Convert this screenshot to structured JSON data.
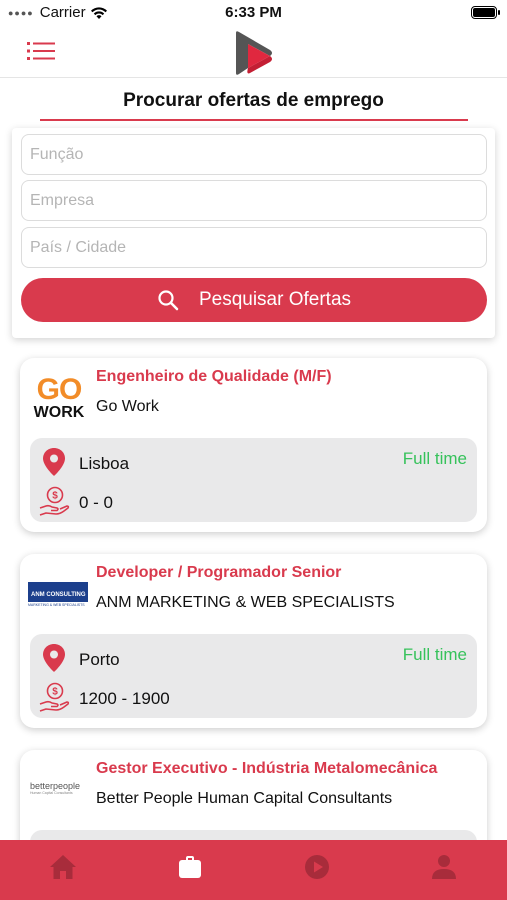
{
  "status_bar": {
    "carrier": "Carrier",
    "time": "6:33 PM"
  },
  "header": {
    "menu_icon": "menu-icon",
    "logo_icon": "play-logo-icon"
  },
  "page": {
    "title": "Procurar ofertas de emprego"
  },
  "search": {
    "role_placeholder": "Função",
    "company_placeholder": "Empresa",
    "location_placeholder": "País / Cidade",
    "button_label": "Pesquisar Ofertas"
  },
  "jobs": [
    {
      "title": "Engenheiro de Qualidade (M/F)",
      "company": "Go Work",
      "logo_text_top": "GO",
      "logo_text_bottom": "WORK",
      "location": "Lisboa",
      "type": "Full time",
      "salary": "0 - 0"
    },
    {
      "title": "Developer / Programador Senior",
      "company": "ANM MARKETING & WEB SPECIALISTS",
      "logo_text_top": "ANM CONSULTING",
      "logo_text_bottom": "MARKETING & WEB SPECIALISTS",
      "location": "Porto",
      "type": "Full time",
      "salary": "1200 - 1900"
    },
    {
      "title": "Gestor Executivo - Indústria Metalomecânica",
      "company": "Better People Human Capital Consultants",
      "logo_text_top": "betterpeople",
      "logo_text_bottom": "Human Capital Consultants",
      "location": "",
      "type": "",
      "salary": ""
    }
  ],
  "tabs": [
    {
      "icon": "home-icon",
      "active": false
    },
    {
      "icon": "briefcase-icon",
      "active": true
    },
    {
      "icon": "play-circle-icon",
      "active": false
    },
    {
      "icon": "user-icon",
      "active": false
    }
  ],
  "colors": {
    "accent": "#d93a4d",
    "job_type": "#36c25b",
    "details_bg": "#e9e9ea",
    "go_work_orange": "#f28c28"
  }
}
